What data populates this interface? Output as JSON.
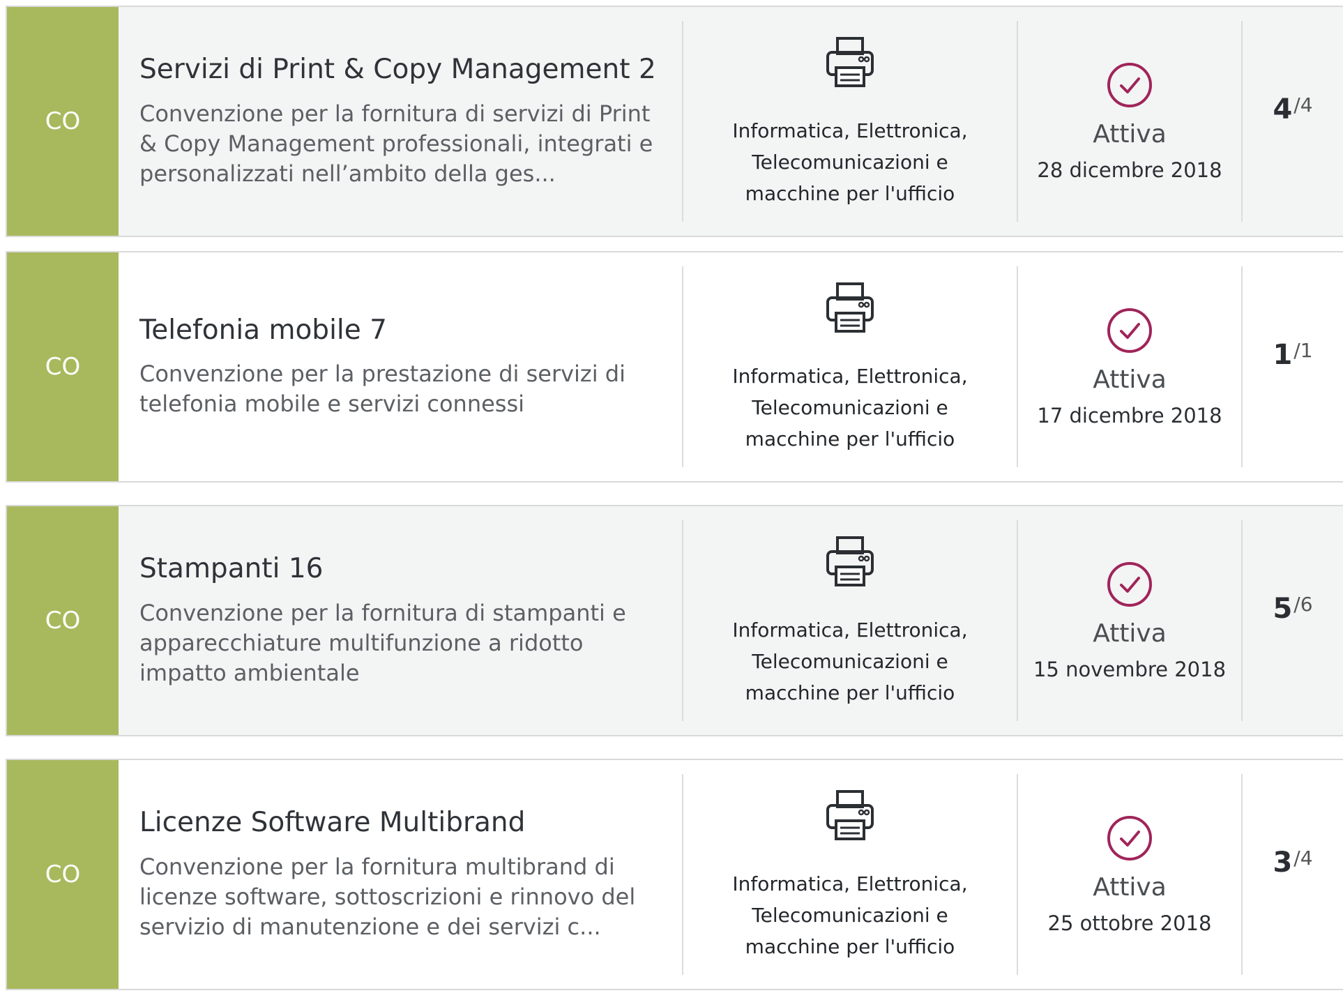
{
  "colors": {
    "badge_green": "#a8b95d",
    "status_accent": "#a0245a",
    "row_shaded": "#f3f4f4"
  },
  "rows": [
    {
      "type_code": "CO",
      "title": "Servizi di Print & Copy Management 2",
      "description": "Convenzione per la fornitura di servizi di Print & Copy Management professionali, integrati e personalizzati nell’ambito della ges...",
      "category_icon": "printer-icon",
      "category": "Informatica, Elettronica, Telecomunicazioni e macchine per l'ufficio",
      "status_icon": "check-circle-icon",
      "status": "Attiva",
      "date": "28 dicembre 2018",
      "lots_current": "4",
      "lots_total": "/4"
    },
    {
      "type_code": "CO",
      "title": "Telefonia mobile 7",
      "description": "Convenzione per la prestazione di servizi di telefonia mobile e servizi connessi",
      "category_icon": "printer-icon",
      "category": "Informatica, Elettronica, Telecomunicazioni e macchine per l'ufficio",
      "status_icon": "check-circle-icon",
      "status": "Attiva",
      "date": "17 dicembre 2018",
      "lots_current": "1",
      "lots_total": "/1"
    },
    {
      "type_code": "CO",
      "title": "Stampanti 16",
      "description": "Convenzione per la fornitura di stampanti e apparecchiature multifunzione a ridotto impatto ambientale",
      "category_icon": "printer-icon",
      "category": "Informatica, Elettronica, Telecomunicazioni e macchine per l'ufficio",
      "status_icon": "check-circle-icon",
      "status": "Attiva",
      "date": "15 novembre 2018",
      "lots_current": "5",
      "lots_total": "/6"
    },
    {
      "type_code": "CO",
      "title": "Licenze Software Multibrand",
      "description": "Convenzione per la fornitura multibrand di licenze software, sottoscrizioni e rinnovo del servizio di manutenzione e dei servizi c...",
      "category_icon": "printer-icon",
      "category": "Informatica, Elettronica, Telecomunicazioni e macchine per l'ufficio",
      "status_icon": "check-circle-icon",
      "status": "Attiva",
      "date": "25 ottobre 2018",
      "lots_current": "3",
      "lots_total": "/4"
    }
  ]
}
